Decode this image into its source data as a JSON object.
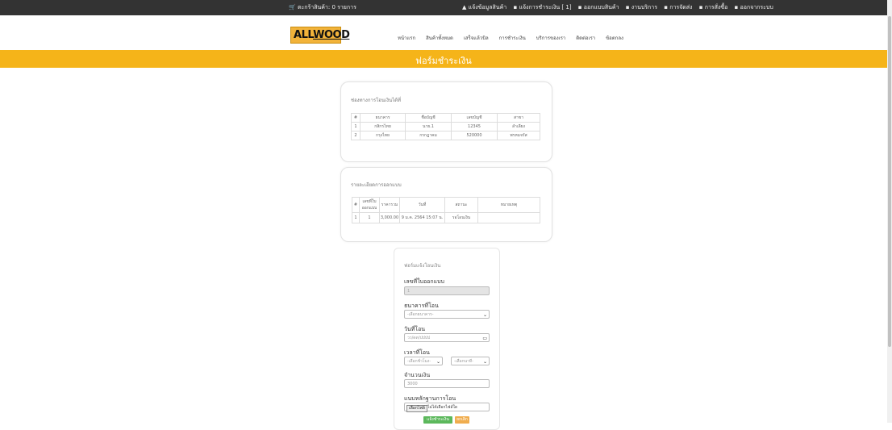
{
  "topbar": {
    "cart": "ตะกร้าสินค้า: 0 รายการ",
    "links": [
      "แจ้งข้อมูลสินค้า",
      "แจ้งการชำระเงิน [ 1]",
      "ออกแบบสินค้า",
      "งานบริการ",
      "การจัดส่ง",
      "การสั่งซื้อ",
      "ออกจากระบบ"
    ]
  },
  "logo": {
    "text_a": "A",
    "text_ll": "LL",
    "text_wood": "WOOD"
  },
  "nav": [
    "หน้าแรก",
    "สินค้าทั้งหมด",
    "เสร็จแล้วบิล",
    "การชำระเงิน",
    "บริการของเรา",
    "ติดต่อเรา",
    "ข้อตกลง"
  ],
  "banner": {
    "title": "ฟอร์มชำระเงิน"
  },
  "bank_card": {
    "title": "ช่องทางการโอนเงินได้ที่",
    "headers": [
      "#",
      "ธนาคาร",
      "ชื่อบัญชี",
      "เลขบัญชี",
      "สาขา"
    ],
    "rows": [
      [
        "1",
        "กสิกรไทย",
        "นาย.1",
        "12345",
        "ลำเลียง"
      ],
      [
        "2",
        "กรุงไทย",
        "กรกฎาคม",
        "520000",
        "พรหมจรัส"
      ]
    ]
  },
  "order_card": {
    "title": "รายละเอียดการออกแบบ",
    "headers": [
      "#",
      "เลขที่ใบ ออกแบบ",
      "ราคารวม",
      "วันที่",
      "สถานะ",
      "หมายเหตุ"
    ],
    "rows": [
      [
        "1",
        "1",
        "3,000.00",
        "9 ม.ค. 2564 15:07 น.",
        "รอโอนเงิน",
        ""
      ]
    ]
  },
  "form": {
    "title": "ฟอร์มแจ้งโอนเงิน",
    "order_no_label": "เลขที่ใบออกแบบ",
    "order_no_value": "1",
    "bank_label": "ธนาคารที่โอน",
    "bank_selected": "-เลือกธนาคาร-",
    "date_label": "วันที่โอน",
    "date_placeholder": "วว/ดด/ปปปป",
    "time_label": "เวลาที่โอน",
    "hour_selected": "-เลือกชั่วโมง-",
    "minute_selected": "-เลือกนาที-",
    "amount_label": "จำนวนเงิน",
    "amount_value": "3000",
    "slip_label": "แนบหลักฐานการโอน",
    "file_button": "เลือกไฟล์",
    "file_status": "ไม่ได้เลือกไฟล์ใด",
    "submit_label": "แจ้งชำระเงิน",
    "cancel_label": "ยกเลิก"
  },
  "colors": {
    "banner": "#f5b419",
    "topbar": "#333333",
    "submit": "#5cb85c",
    "cancel": "#f0ad4e"
  }
}
